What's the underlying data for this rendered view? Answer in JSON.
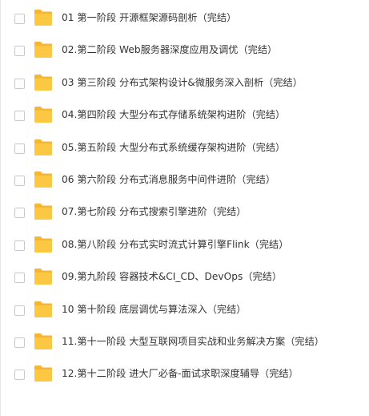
{
  "colors": {
    "folder_body": "#fcc843",
    "folder_tab": "#f6b633",
    "text": "#333333",
    "checkbox_border": "#c9c9c9"
  },
  "files": [
    {
      "name": "01 第一阶段 开源框架源码剖析（完结）",
      "icon": "folder-icon"
    },
    {
      "name": "02.第二阶段 Web服务器深度应用及调优（完结）",
      "icon": "folder-icon"
    },
    {
      "name": "03 第三阶段 分布式架构设计&微服务深入剖析（完结）",
      "icon": "folder-icon"
    },
    {
      "name": "04.第四阶段 大型分布式存储系统架构进阶（完结）",
      "icon": "folder-icon"
    },
    {
      "name": "05.第五阶段 大型分布式系统缓存架构进阶（完结）",
      "icon": "folder-icon"
    },
    {
      "name": "06 第六阶段 分布式消息服务中间件进阶（完结）",
      "icon": "folder-icon"
    },
    {
      "name": "07.第七阶段 分布式搜索引擎进阶（完结）",
      "icon": "folder-icon"
    },
    {
      "name": "08.第八阶段 分布式实时流式计算引擎Flink（完结）",
      "icon": "folder-icon"
    },
    {
      "name": "09.第九阶段 容器技术&CI_CD、DevOps（完结）",
      "icon": "folder-icon"
    },
    {
      "name": "10 第十阶段 底层调优与算法深入（完结）",
      "icon": "folder-icon"
    },
    {
      "name": "11.第十一阶段 大型互联网项目实战和业务解决方案（完结）",
      "icon": "folder-icon"
    },
    {
      "name": "12.第十二阶段 进大厂必备-面试求职深度辅导（完结）",
      "icon": "folder-icon"
    }
  ]
}
